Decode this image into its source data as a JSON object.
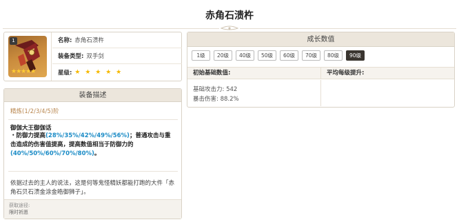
{
  "page": {
    "title": "赤角石溃杵"
  },
  "info": {
    "thumb_badge": "1",
    "thumb_stars": "★★★★★",
    "name_label": "名称:",
    "name_value": "赤角石溃杵",
    "type_label": "装备类型:",
    "type_value": "双手剑",
    "rarity_label": "星级:",
    "rarity_value": "★ ★ ★ ★ ★"
  },
  "growth": {
    "header": "成长数值",
    "levels": [
      "1级",
      "20级",
      "40级",
      "50级",
      "60级",
      "70级",
      "80级",
      "90级"
    ],
    "active_level": "90级",
    "base_stats_header": "初始基础数值:",
    "avg_growth_header": "平均每级提升:",
    "atk_line": "基础攻击力: 542",
    "crit_line": "暴击伤害: 88.2%"
  },
  "description": {
    "header": "装备描述",
    "refine": "精炼(1/2/3/4/5)阶",
    "skill_name": "御伽大王御伽话",
    "skill_p1": "・防御力提高",
    "skill_h1": "(28%/35%/42%/49%/56%)",
    "skill_p2": "；普通攻击与重击造成的伤害值提高，提高数值相当于防御力的",
    "skill_h2": "(40%/50%/60%/70%/80%)",
    "skill_p3": "。",
    "lore": "依据过去的主人的说法，这是何等鬼怪精妖都能打跑的大件「赤角石贝石溃金涂金晧御狮子」。",
    "source_label": "获取途径:",
    "source_value": "限时祈愿"
  },
  "colors": {
    "highlight": "#1a8bc6",
    "refine": "#b9874f",
    "header_bg": "#ece6dc",
    "active_tab": "#3a3530"
  }
}
